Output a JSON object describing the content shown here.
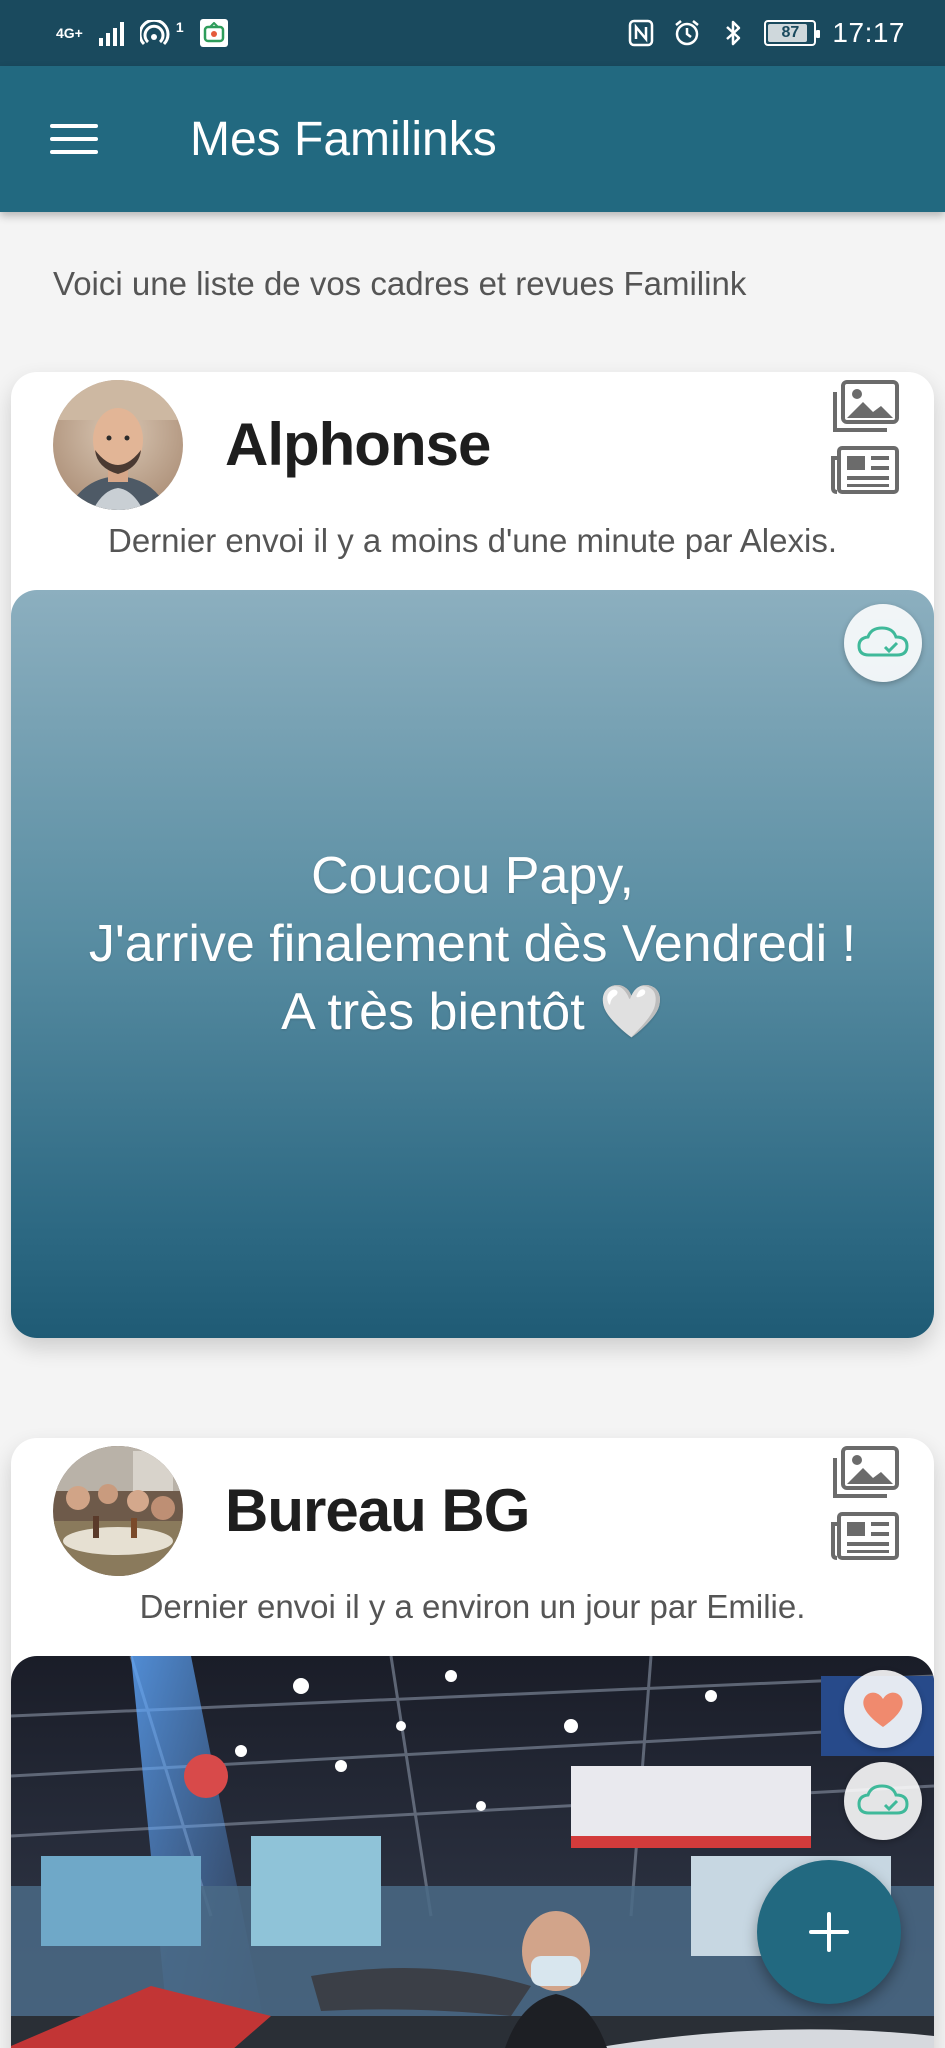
{
  "status_bar": {
    "network_label": "4G+",
    "hotspot_count": "1",
    "battery_level": "87",
    "battery_fraction": 0.87,
    "time": "17:17",
    "icons": [
      "signal-icon",
      "hotspot-icon",
      "app-notification-icon",
      "nfc-icon",
      "alarm-icon",
      "bluetooth-icon",
      "battery-icon"
    ]
  },
  "app_bar": {
    "title": "Mes Familinks",
    "menu_icon": "hamburger-menu-icon"
  },
  "intro": "Voici une liste de vos cadres et revues Familink",
  "cards": [
    {
      "name": "Alphonse",
      "last_sent": "Dernier envoi il y a moins d'une minute par Alexis.",
      "latest_item": {
        "type": "message",
        "text": "Coucou Papy,\nJ'arrive finalement dès Vendredi !\nA très bientôt 🤍",
        "badges": [
          "cloud-synced-icon"
        ]
      },
      "actions": [
        "gallery-icon",
        "newspaper-icon"
      ]
    },
    {
      "name": "Bureau BG",
      "last_sent": "Dernier envoi il y a environ un jour par Emilie.",
      "latest_item": {
        "type": "photo",
        "badges": [
          "heart-icon",
          "cloud-synced-icon"
        ]
      },
      "actions": [
        "gallery-icon",
        "newspaper-icon"
      ]
    }
  ],
  "fab": {
    "icon": "plus-icon"
  },
  "colors": {
    "status_bar": "#1a4a5e",
    "app_bar": "#226980",
    "sync_green": "#3fb99a",
    "heart": "#f08a6e",
    "icon_gray": "#6b6b6b"
  }
}
